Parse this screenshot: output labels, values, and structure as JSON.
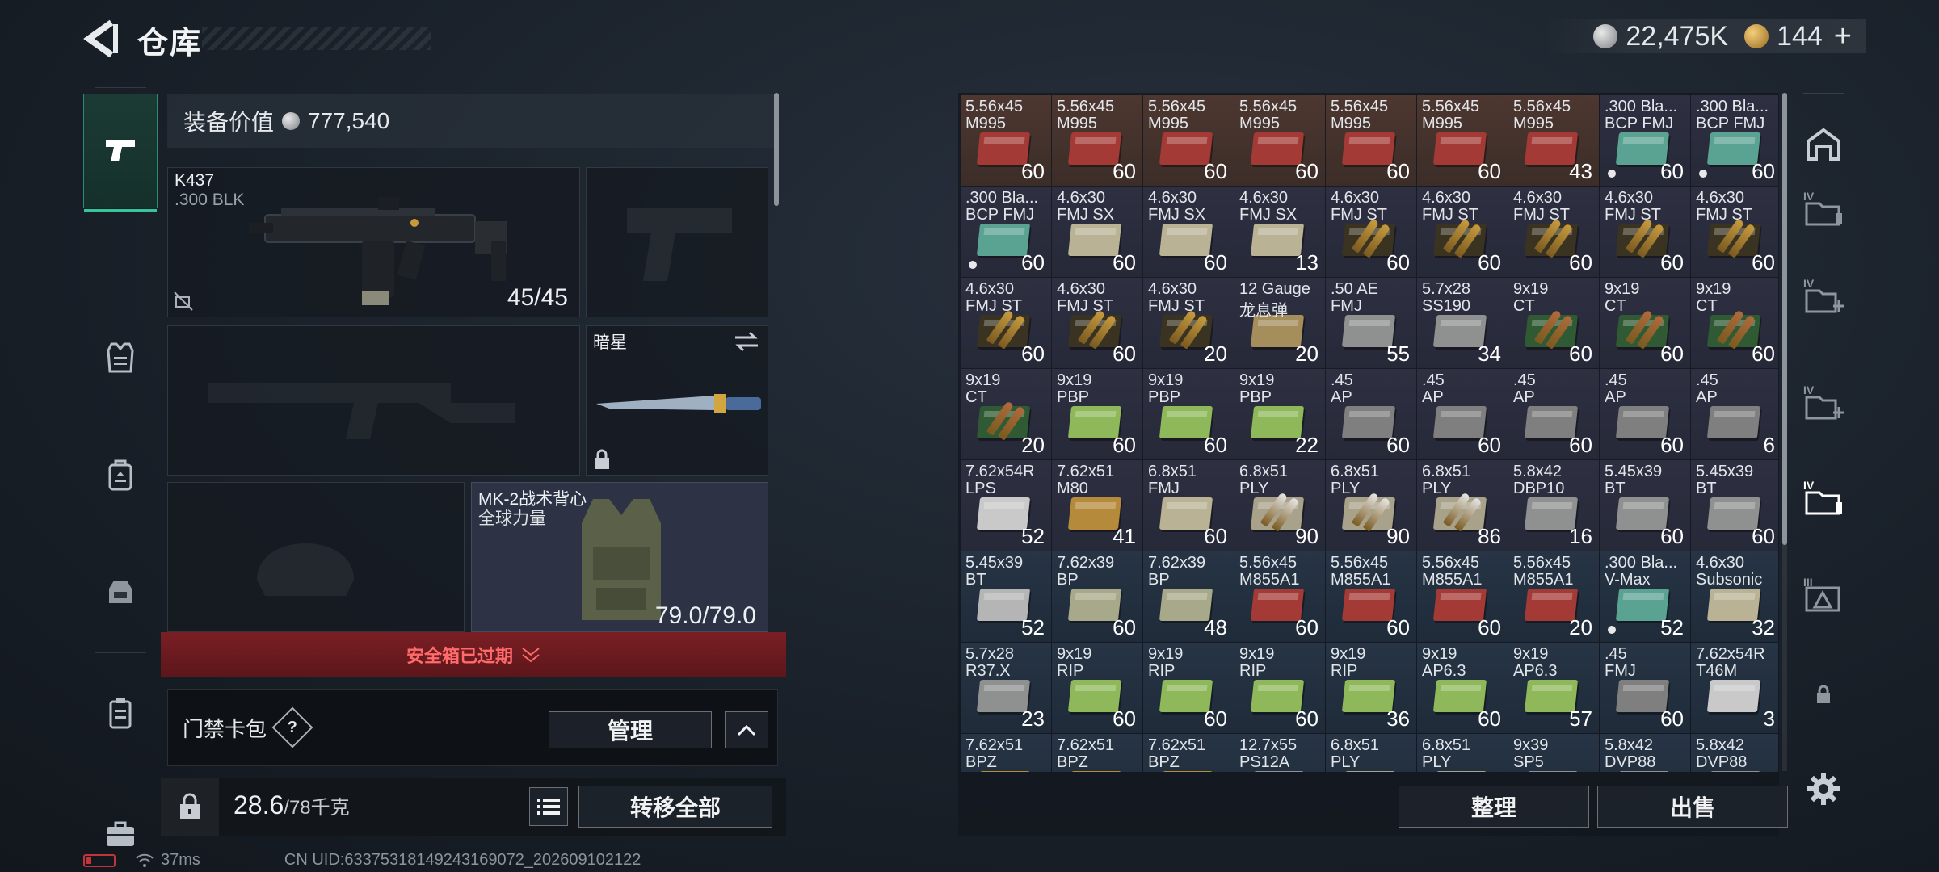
{
  "header": {
    "title": "仓库",
    "currency_silver": "22,475K",
    "currency_gold": "144"
  },
  "equipment": {
    "value_label": "装备价值",
    "value": "777,540",
    "primary_weapon": {
      "name": "K437",
      "caliber": ".300 BLK",
      "ammo": "45/45"
    },
    "melee": {
      "name": "暗星"
    },
    "vest": {
      "name": "MK-2战术背心",
      "sub": "全球力量",
      "durability": "79.0/79.0"
    },
    "safe_box_status": "安全箱已过期",
    "card_pack_label": "门禁卡包",
    "manage_label": "管理",
    "weight_value": "28.6",
    "weight_max": "/78千克",
    "transfer_all_label": "转移全部"
  },
  "inventory": {
    "sort_label": "整理",
    "sell_label": "出售",
    "items": [
      {
        "n1": "5.56x45",
        "n2": "M995",
        "count": "60",
        "tier": "red",
        "box": "#a33a36"
      },
      {
        "n1": "5.56x45",
        "n2": "M995",
        "count": "60",
        "tier": "red",
        "box": "#a33a36"
      },
      {
        "n1": "5.56x45",
        "n2": "M995",
        "count": "60",
        "tier": "red",
        "box": "#a33a36"
      },
      {
        "n1": "5.56x45",
        "n2": "M995",
        "count": "60",
        "tier": "red",
        "box": "#a33a36"
      },
      {
        "n1": "5.56x45",
        "n2": "M995",
        "count": "60",
        "tier": "red",
        "box": "#a33a36"
      },
      {
        "n1": "5.56x45",
        "n2": "M995",
        "count": "60",
        "tier": "red",
        "box": "#a33a36"
      },
      {
        "n1": "5.56x45",
        "n2": "M995",
        "count": "43",
        "tier": "red",
        "box": "#a33a36"
      },
      {
        "n1": ".300 Bla...",
        "n2": "BCP FMJ",
        "count": "60",
        "tier": "purple",
        "box": "#5aa392",
        "dot": true
      },
      {
        "n1": ".300 Bla...",
        "n2": "BCP FMJ",
        "count": "60",
        "tier": "purple",
        "box": "#5aa392",
        "dot": true
      },
      {
        "n1": ".300 Bla...",
        "n2": "BCP FMJ",
        "count": "60",
        "tier": "purple",
        "box": "#5aa392",
        "dot": true
      },
      {
        "n1": "4.6x30",
        "n2": "FMJ SX",
        "count": "60",
        "tier": "purple",
        "box": "#b9b294"
      },
      {
        "n1": "4.6x30",
        "n2": "FMJ SX",
        "count": "60",
        "tier": "purple",
        "box": "#b9b294"
      },
      {
        "n1": "4.6x30",
        "n2": "FMJ SX",
        "count": "13",
        "tier": "purple",
        "box": "#b9b294"
      },
      {
        "n1": "4.6x30",
        "n2": "FMJ ST",
        "count": "60",
        "tier": "purple",
        "box": "#3b3322",
        "bullet": "#c79b3e"
      },
      {
        "n1": "4.6x30",
        "n2": "FMJ ST",
        "count": "60",
        "tier": "purple",
        "box": "#3b3322",
        "bullet": "#c79b3e"
      },
      {
        "n1": "4.6x30",
        "n2": "FMJ ST",
        "count": "60",
        "tier": "purple",
        "box": "#3b3322",
        "bullet": "#c79b3e"
      },
      {
        "n1": "4.6x30",
        "n2": "FMJ ST",
        "count": "60",
        "tier": "purple",
        "box": "#3b3322",
        "bullet": "#c79b3e"
      },
      {
        "n1": "4.6x30",
        "n2": "FMJ ST",
        "count": "60",
        "tier": "purple",
        "box": "#3b3322",
        "bullet": "#c79b3e"
      },
      {
        "n1": "4.6x30",
        "n2": "FMJ ST",
        "count": "60",
        "tier": "purple",
        "box": "#3b3322",
        "bullet": "#c79b3e"
      },
      {
        "n1": "4.6x30",
        "n2": "FMJ ST",
        "count": "60",
        "tier": "purple",
        "box": "#3b3322",
        "bullet": "#c79b3e"
      },
      {
        "n1": "4.6x30",
        "n2": "FMJ ST",
        "count": "20",
        "tier": "purple",
        "box": "#3b3322",
        "bullet": "#c79b3e"
      },
      {
        "n1": "12 Gauge",
        "n2": "龙息弹",
        "count": "20",
        "tier": "purple",
        "box": "#a58d5c"
      },
      {
        "n1": ".50 AE",
        "n2": "FMJ",
        "count": "55",
        "tier": "purple",
        "box": "#8f9090"
      },
      {
        "n1": "5.7x28",
        "n2": "SS190",
        "count": "34",
        "tier": "purple",
        "box": "#8f9090"
      },
      {
        "n1": "9x19",
        "n2": "CT",
        "count": "60",
        "tier": "purple",
        "box": "#2f5a33",
        "bullet": "#b06a3b"
      },
      {
        "n1": "9x19",
        "n2": "CT",
        "count": "60",
        "tier": "purple",
        "box": "#2f5a33",
        "bullet": "#b06a3b"
      },
      {
        "n1": "9x19",
        "n2": "CT",
        "count": "60",
        "tier": "purple",
        "box": "#2f5a33",
        "bullet": "#b06a3b"
      },
      {
        "n1": "9x19",
        "n2": "CT",
        "count": "20",
        "tier": "purple",
        "box": "#2f5a33",
        "bullet": "#b06a3b"
      },
      {
        "n1": "9x19",
        "n2": "PBP",
        "count": "60",
        "tier": "purple",
        "box": "#8fb85a"
      },
      {
        "n1": "9x19",
        "n2": "PBP",
        "count": "60",
        "tier": "purple",
        "box": "#8fb85a"
      },
      {
        "n1": "9x19",
        "n2": "PBP",
        "count": "22",
        "tier": "purple",
        "box": "#8fb85a"
      },
      {
        "n1": ".45",
        "n2": "AP",
        "count": "60",
        "tier": "purple",
        "box": "#7f7f80"
      },
      {
        "n1": ".45",
        "n2": "AP",
        "count": "60",
        "tier": "purple",
        "box": "#7f7f80"
      },
      {
        "n1": ".45",
        "n2": "AP",
        "count": "60",
        "tier": "purple",
        "box": "#7f7f80"
      },
      {
        "n1": ".45",
        "n2": "AP",
        "count": "60",
        "tier": "purple",
        "box": "#7f7f80"
      },
      {
        "n1": ".45",
        "n2": "AP",
        "count": "6",
        "tier": "purple",
        "box": "#7f7f80"
      },
      {
        "n1": "7.62x54R",
        "n2": "LPS",
        "count": "52",
        "tier": "purple",
        "box": "#c9c9c9"
      },
      {
        "n1": "7.62x51",
        "n2": "M80",
        "count": "41",
        "tier": "purple",
        "box": "#b58a3a"
      },
      {
        "n1": "6.8x51",
        "n2": "FMJ",
        "count": "60",
        "tier": "purple",
        "box": "#b9b294"
      },
      {
        "n1": "6.8x51",
        "n2": "PLY",
        "count": "90",
        "tier": "purple",
        "box": "#a9a28a",
        "bullet": "#e6e6e6"
      },
      {
        "n1": "6.8x51",
        "n2": "PLY",
        "count": "90",
        "tier": "purple",
        "box": "#a9a28a",
        "bullet": "#e6e6e6"
      },
      {
        "n1": "6.8x51",
        "n2": "PLY",
        "count": "86",
        "tier": "purple",
        "box": "#a9a28a",
        "bullet": "#e6e6e6"
      },
      {
        "n1": "5.8x42",
        "n2": "DBP10",
        "count": "16",
        "tier": "purple",
        "box": "#8f9090"
      },
      {
        "n1": "5.45x39",
        "n2": "BT",
        "count": "60",
        "tier": "purple",
        "box": "#8f9090"
      },
      {
        "n1": "5.45x39",
        "n2": "BT",
        "count": "60",
        "tier": "purple",
        "box": "#8f9090"
      },
      {
        "n1": "5.45x39",
        "n2": "BT",
        "count": "52",
        "tier": "blue",
        "box": "#b5b5b5"
      },
      {
        "n1": "7.62x39",
        "n2": "BP",
        "count": "60",
        "tier": "blue",
        "box": "#a8a88a"
      },
      {
        "n1": "7.62x39",
        "n2": "BP",
        "count": "48",
        "tier": "blue",
        "box": "#a8a88a"
      },
      {
        "n1": "5.56x45",
        "n2": "M855A1",
        "count": "60",
        "tier": "blue",
        "box": "#a33a36"
      },
      {
        "n1": "5.56x45",
        "n2": "M855A1",
        "count": "60",
        "tier": "blue",
        "box": "#a33a36"
      },
      {
        "n1": "5.56x45",
        "n2": "M855A1",
        "count": "60",
        "tier": "blue",
        "box": "#a33a36"
      },
      {
        "n1": "5.56x45",
        "n2": "M855A1",
        "count": "20",
        "tier": "blue",
        "box": "#a33a36"
      },
      {
        "n1": ".300 Bla...",
        "n2": "V-Max",
        "count": "52",
        "tier": "blue",
        "box": "#5aa392",
        "dot": true
      },
      {
        "n1": "4.6x30",
        "n2": "Subsonic",
        "count": "32",
        "tier": "blue",
        "box": "#b9b294"
      },
      {
        "n1": "5.7x28",
        "n2": "R37.X",
        "count": "23",
        "tier": "blue",
        "box": "#8f9090"
      },
      {
        "n1": "9x19",
        "n2": "RIP",
        "count": "60",
        "tier": "blue",
        "box": "#8fb85a"
      },
      {
        "n1": "9x19",
        "n2": "RIP",
        "count": "60",
        "tier": "blue",
        "box": "#8fb85a"
      },
      {
        "n1": "9x19",
        "n2": "RIP",
        "count": "60",
        "tier": "blue",
        "box": "#8fb85a"
      },
      {
        "n1": "9x19",
        "n2": "RIP",
        "count": "36",
        "tier": "blue",
        "box": "#8fb85a"
      },
      {
        "n1": "9x19",
        "n2": "AP6.3",
        "count": "60",
        "tier": "blue",
        "box": "#8fb85a"
      },
      {
        "n1": "9x19",
        "n2": "AP6.3",
        "count": "57",
        "tier": "blue",
        "box": "#8fb85a"
      },
      {
        "n1": ".45",
        "n2": "FMJ",
        "count": "60",
        "tier": "blue",
        "box": "#7f7f80"
      },
      {
        "n1": "7.62x54R",
        "n2": "T46M",
        "count": "3",
        "tier": "blue",
        "box": "#c9c9c9"
      },
      {
        "n1": "7.62x51",
        "n2": "BPZ",
        "count": "",
        "tier": "blue",
        "box": "#b58a3a"
      },
      {
        "n1": "7.62x51",
        "n2": "BPZ",
        "count": "",
        "tier": "blue",
        "box": "#b58a3a"
      },
      {
        "n1": "7.62x51",
        "n2": "BPZ",
        "count": "",
        "tier": "blue",
        "box": "#b58a3a"
      },
      {
        "n1": "12.7x55",
        "n2": "PS12A",
        "count": "",
        "tier": "blue",
        "box": "#8f9090"
      },
      {
        "n1": "6.8x51",
        "n2": "PLY",
        "count": "",
        "tier": "blue",
        "box": "#a9a28a"
      },
      {
        "n1": "6.8x51",
        "n2": "PLY",
        "count": "",
        "tier": "blue",
        "box": "#a9a28a"
      },
      {
        "n1": "9x39",
        "n2": "SP5",
        "count": "",
        "tier": "blue",
        "box": "#8f9090"
      },
      {
        "n1": "5.8x42",
        "n2": "DVP88",
        "count": "",
        "tier": "blue",
        "box": "#8f9090"
      },
      {
        "n1": "5.8x42",
        "n2": "DVP88",
        "count": "",
        "tier": "blue",
        "box": "#8f9090"
      }
    ]
  },
  "status": {
    "ping": "37ms",
    "uid": "CN UID:6337531814924316​9072_202609102122"
  }
}
